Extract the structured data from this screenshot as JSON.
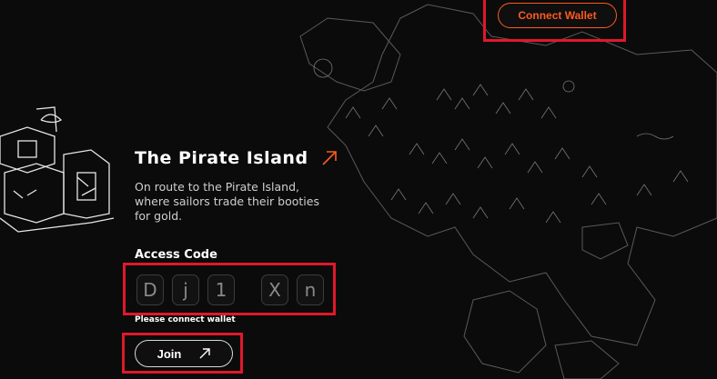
{
  "header": {
    "connect_wallet_label": "Connect Wallet"
  },
  "hero": {
    "title": "The Pirate Island",
    "description": "On route to the Pirate Island, where sailors trade their booties for gold."
  },
  "access": {
    "label": "Access Code",
    "code_chars": [
      "D",
      "j",
      "1",
      "X",
      "n"
    ],
    "hint": "Please connect wallet"
  },
  "join": {
    "label": "Join"
  },
  "colors": {
    "accent": "#ff5a1f",
    "background": "#0b0b0b",
    "annotation": "#e0182b"
  },
  "icons": {
    "title_link": "arrow-up-right-icon",
    "join_link": "arrow-up-right-icon"
  }
}
